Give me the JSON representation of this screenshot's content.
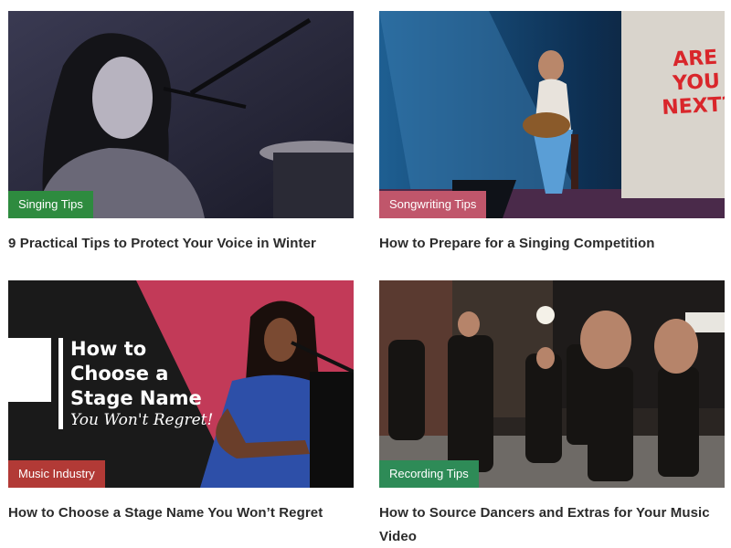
{
  "articles": [
    {
      "category": "Singing Tips",
      "category_color": "#2e8b3f",
      "title": "9 Practical Tips to Protect Your Voice in Winter",
      "image_alt": "Woman at microphone in black and white"
    },
    {
      "category": "Songwriting Tips",
      "category_color": "#c0566b",
      "title": "How to Prepare for a Singing Competition",
      "image_alt": "Woman performing with guitar on stage",
      "poster": [
        "ARE",
        "YOU",
        "NEXT?"
      ]
    },
    {
      "category": "Music Industry",
      "category_color": "#b23a36",
      "title": "How to Choose a Stage Name You Won’t Regret",
      "image_alt": "Singer at piano with title graphic",
      "overlay": {
        "line1": "How to",
        "line2": "Choose a",
        "line3": "Stage Name",
        "script": "You Won't Regret!"
      }
    },
    {
      "category": "Recording Tips",
      "category_color": "#2e8b57",
      "title": "How to Source Dancers and Extras for Your Music Video",
      "image_alt": "Dancers performing in industrial space"
    }
  ]
}
